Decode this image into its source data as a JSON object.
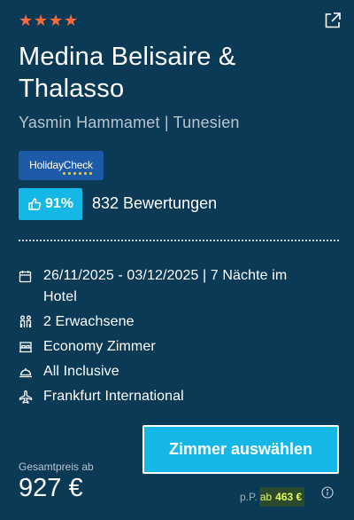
{
  "hotel": {
    "stars": 4,
    "name": "Medina Belisaire & Thalasso",
    "location": "Yasmin Hammamet | Tunesien"
  },
  "holidaycheck": {
    "logo_text": "HolidayCheck",
    "recommendation": "91%",
    "reviews": "832 Bewertungen"
  },
  "details": {
    "dates": "26/11/2025 - 03/12/2025 | 7 Nächte im Hotel",
    "travelers": "2 Erwachsene",
    "room": "Economy Zimmer",
    "board": "All Inclusive",
    "airport": "Frankfurt International"
  },
  "cta": {
    "label": "Zimmer auswählen"
  },
  "price": {
    "total_label": "Gesamtpreis ab",
    "total": "927 €",
    "per_person_label": "p.P.",
    "per_person_prefix": "ab",
    "per_person_amount": "463 €"
  },
  "colors": {
    "background": "#0b3a56",
    "accent": "#14b7e6",
    "star": "#ff6a3d",
    "highlight_text": "#e4ff48"
  },
  "icons": {
    "share": "share-icon",
    "calendar": "calendar-icon",
    "travelers": "travelers-icon",
    "room": "bed-icon",
    "board": "cloche-icon",
    "airport": "plane-icon",
    "info": "info-icon",
    "thumb": "thumbs-up-icon",
    "star": "star-icon"
  }
}
